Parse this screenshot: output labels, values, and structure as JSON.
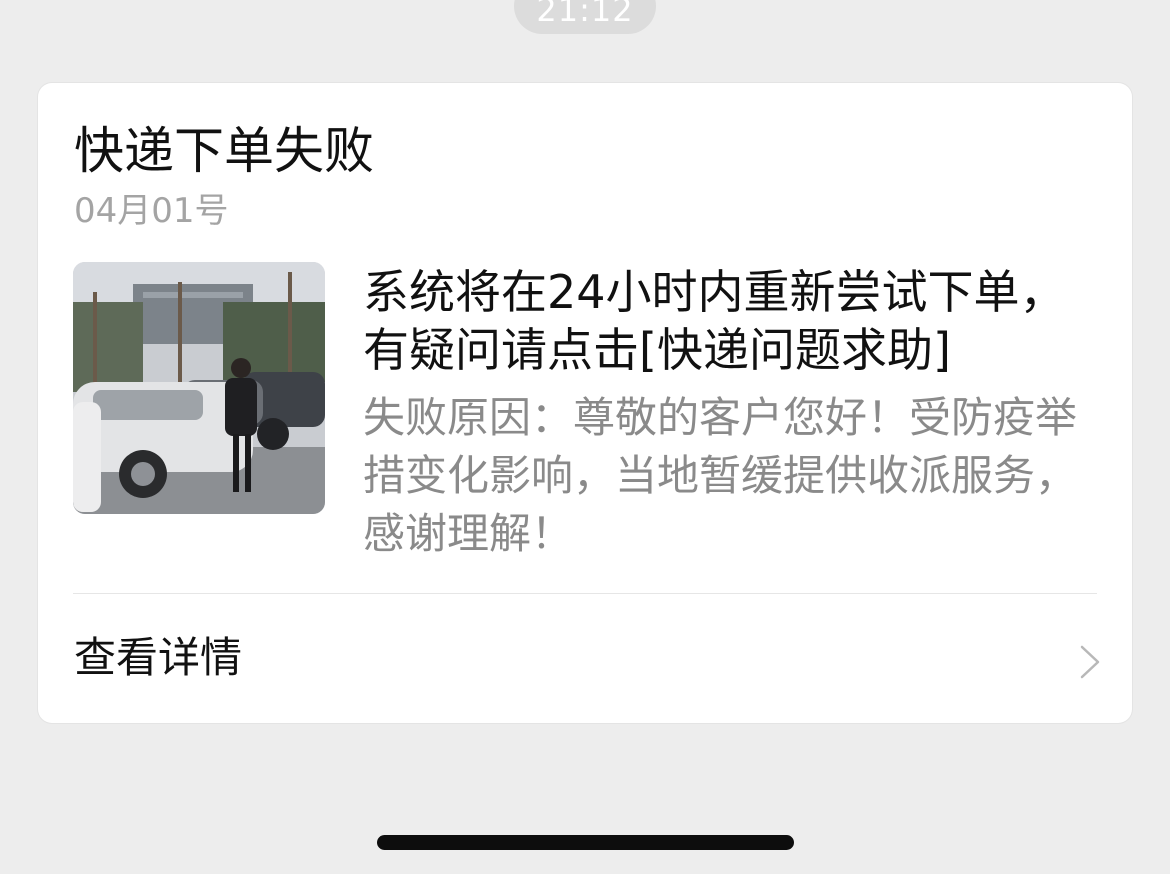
{
  "timestamp": "21:12",
  "card": {
    "title": "快递下单失败",
    "date": "04月01号",
    "thumbnail": "photo of a person posing beside parked cars",
    "message": "系统将在24小时内重新尝试下单，有疑问请点击[快递问题求助]",
    "reason": "失败原因：尊敬的客户您好！受防疫举措变化影响，当地暂缓提供收派服务，感谢理解！",
    "details_label": "查看详情",
    "details_icon": "chevron-right-icon"
  },
  "colors": {
    "background": "#ededed",
    "card": "#ffffff",
    "title_text": "#111111",
    "secondary_text": "#8a8a8a"
  }
}
